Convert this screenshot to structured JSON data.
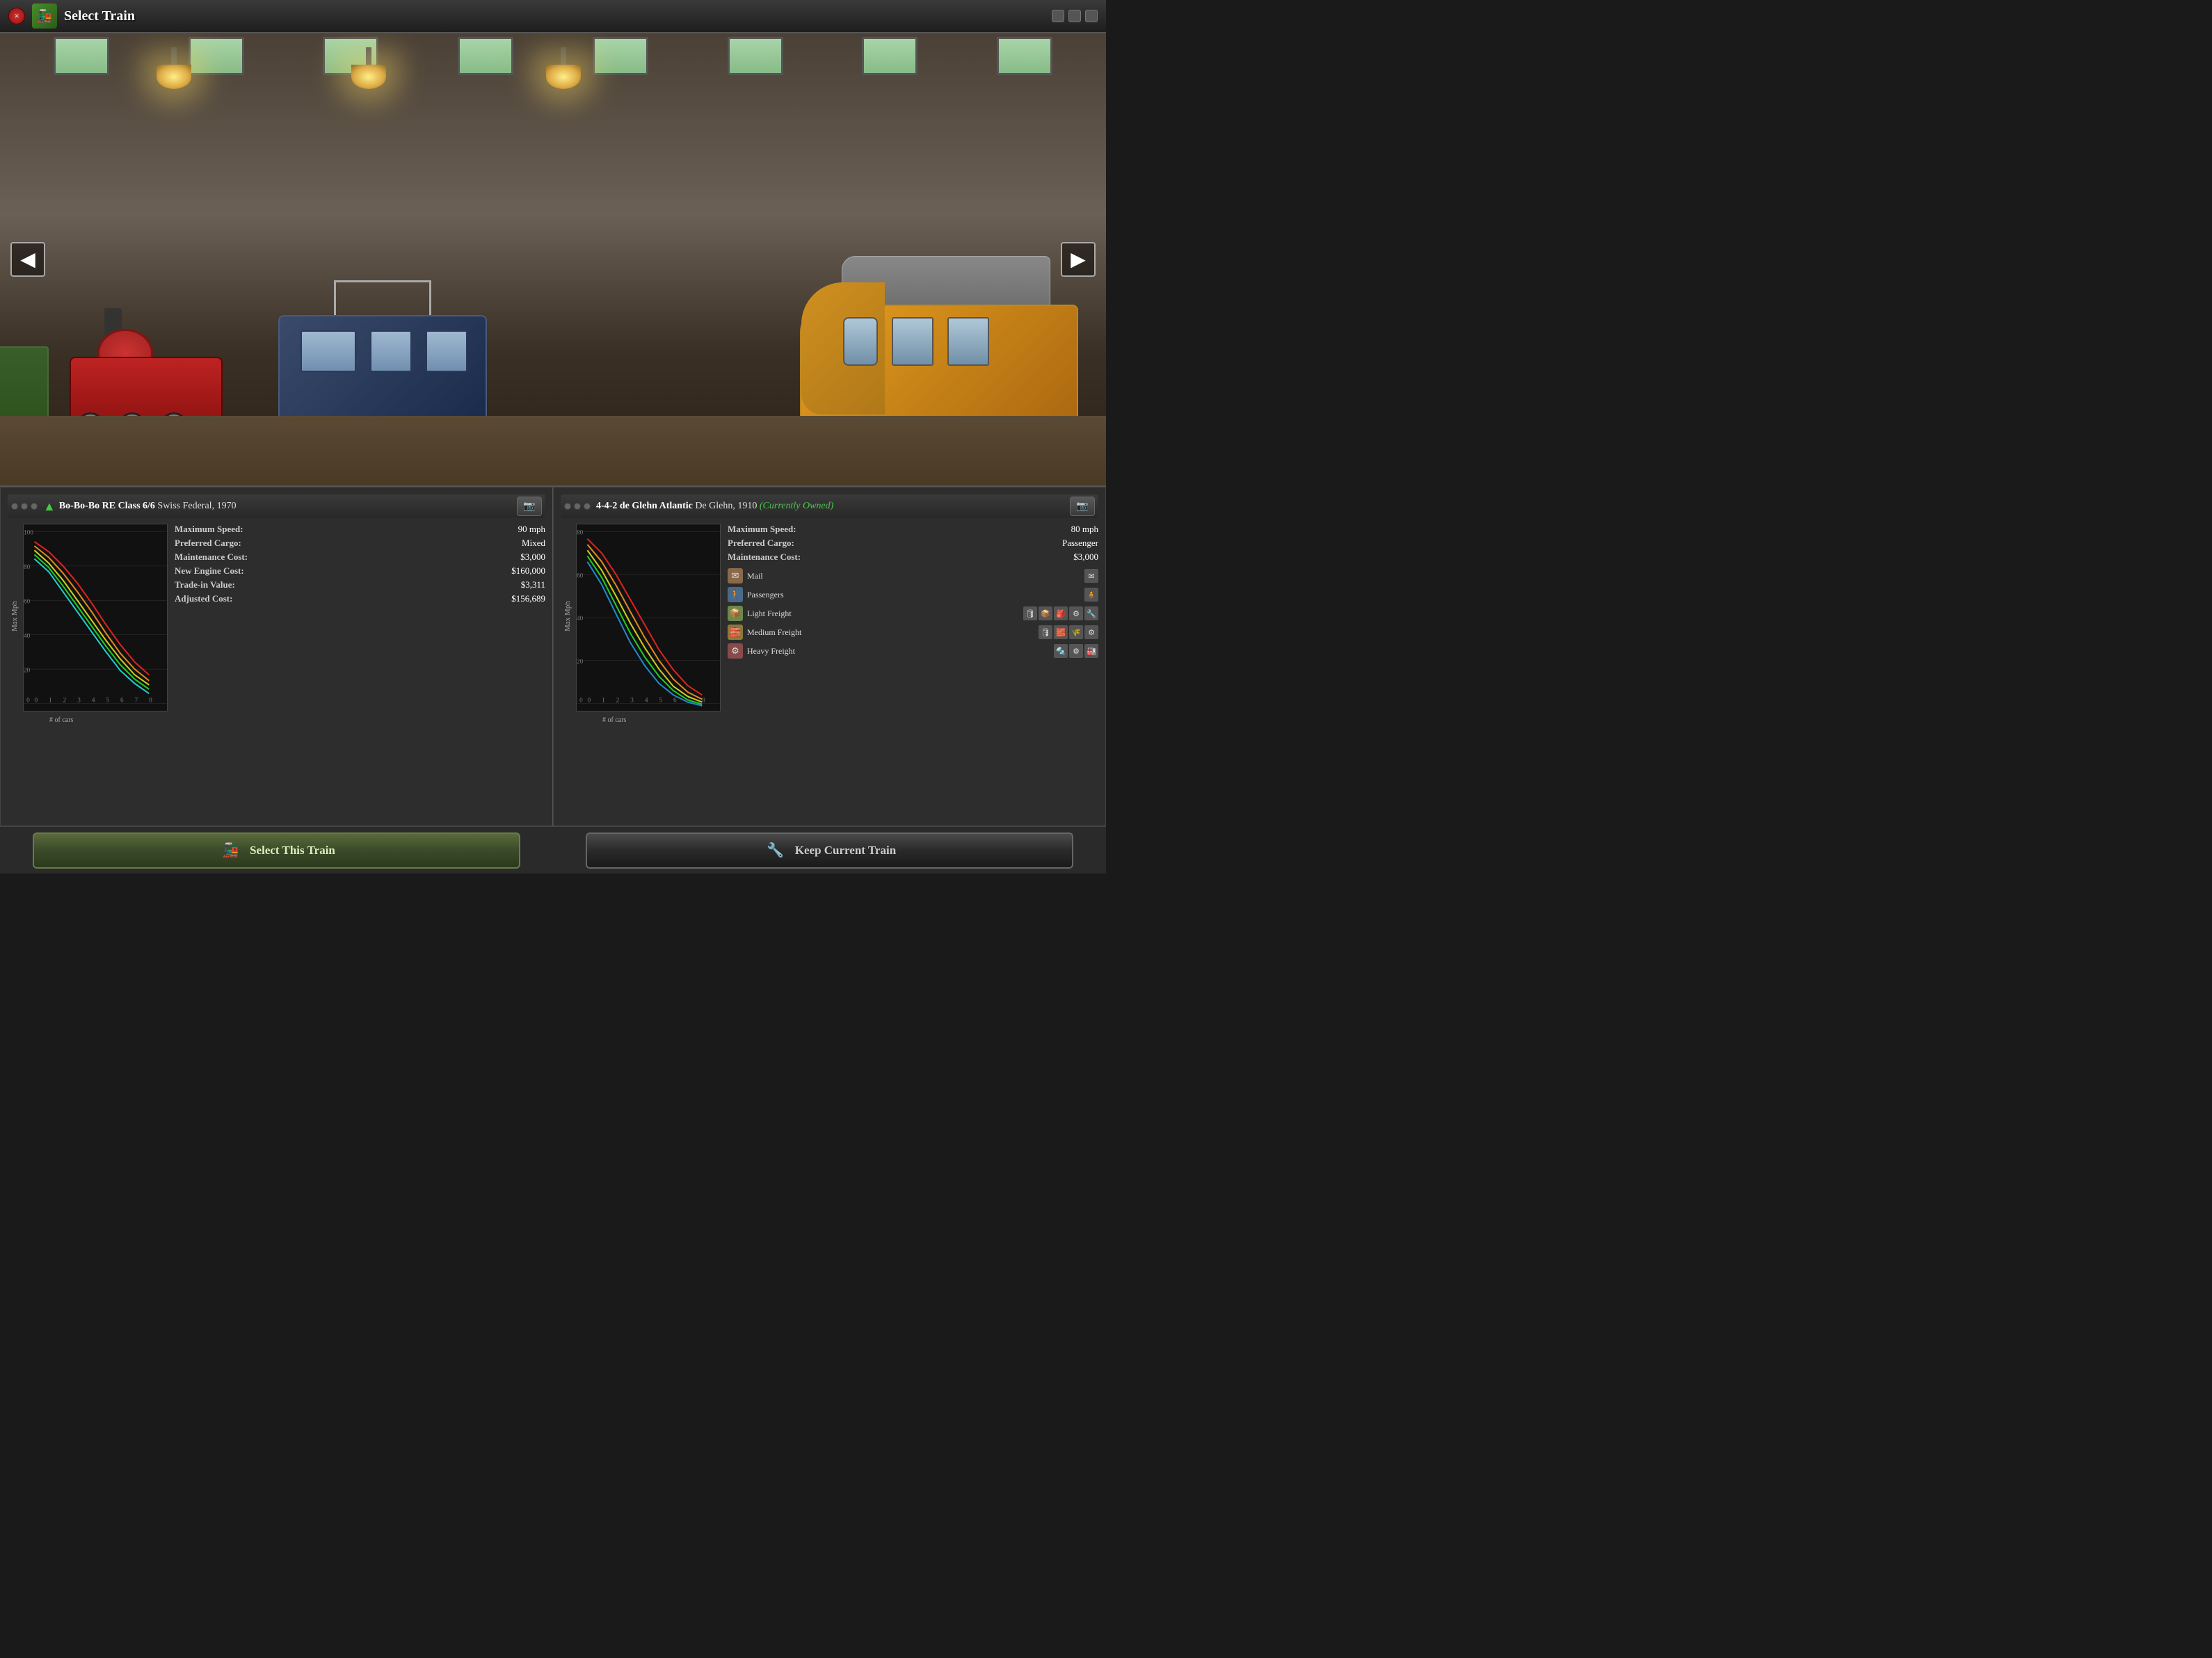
{
  "window": {
    "title": "Select Train",
    "close_label": "×"
  },
  "trains": {
    "left_train": {
      "full_name": "Bo-Bo-Bo RE Class 6/6 Swiss Federal, 1970",
      "name_bold": "Bo-Bo-Bo RE Class 6/6",
      "name_detail": "Swiss Federal, 1970",
      "owned": false,
      "max_speed": "90 mph",
      "preferred_cargo": "Mixed",
      "maintenance_cost": "$3,000",
      "new_engine_cost": "$160,000",
      "trade_in_value": "$3,311",
      "adjusted_cost": "$156,689",
      "chart_max_y": 100
    },
    "right_train": {
      "full_name": "4-4-2 de Glehn Atlantic De Glehn, 1910 (Currently Owned)",
      "name_bold": "4-4-2 de Glehn Atlantic",
      "name_detail": "De Glehn, 1910",
      "owned_label": "(Currently Owned)",
      "max_speed": "80 mph",
      "preferred_cargo": "Passenger",
      "maintenance_cost": "$3,000",
      "chart_max_y": 80,
      "cargo_items": [
        {
          "name": "Mail",
          "icon": "✉"
        },
        {
          "name": "Passengers",
          "icon": "🚶"
        },
        {
          "name": "Light Freight",
          "icon": "📦"
        },
        {
          "name": "Medium Freight",
          "icon": "🧱"
        },
        {
          "name": "Heavy Freight",
          "icon": "⚙"
        }
      ]
    }
  },
  "buttons": {
    "select_train": "Select This Train",
    "keep_train": "Keep Current Train"
  },
  "labels": {
    "max_speed": "Maximum Speed:",
    "preferred_cargo": "Preferred Cargo:",
    "maintenance_cost": "Maintenance Cost:",
    "new_engine_cost": "New Engine Cost:",
    "trade_in_value": "Trade-in Value:",
    "adjusted_cost": "Adjusted Cost:",
    "chart_x": "# of cars",
    "chart_y": "Max Mph",
    "y_axis": [
      "100",
      "80",
      "60",
      "40",
      "20",
      "0"
    ],
    "y_axis_right": [
      "80",
      "60",
      "40",
      "20",
      "0"
    ],
    "x_axis": [
      "0",
      "1",
      "2",
      "3",
      "4",
      "5",
      "6",
      "7",
      "8"
    ]
  }
}
